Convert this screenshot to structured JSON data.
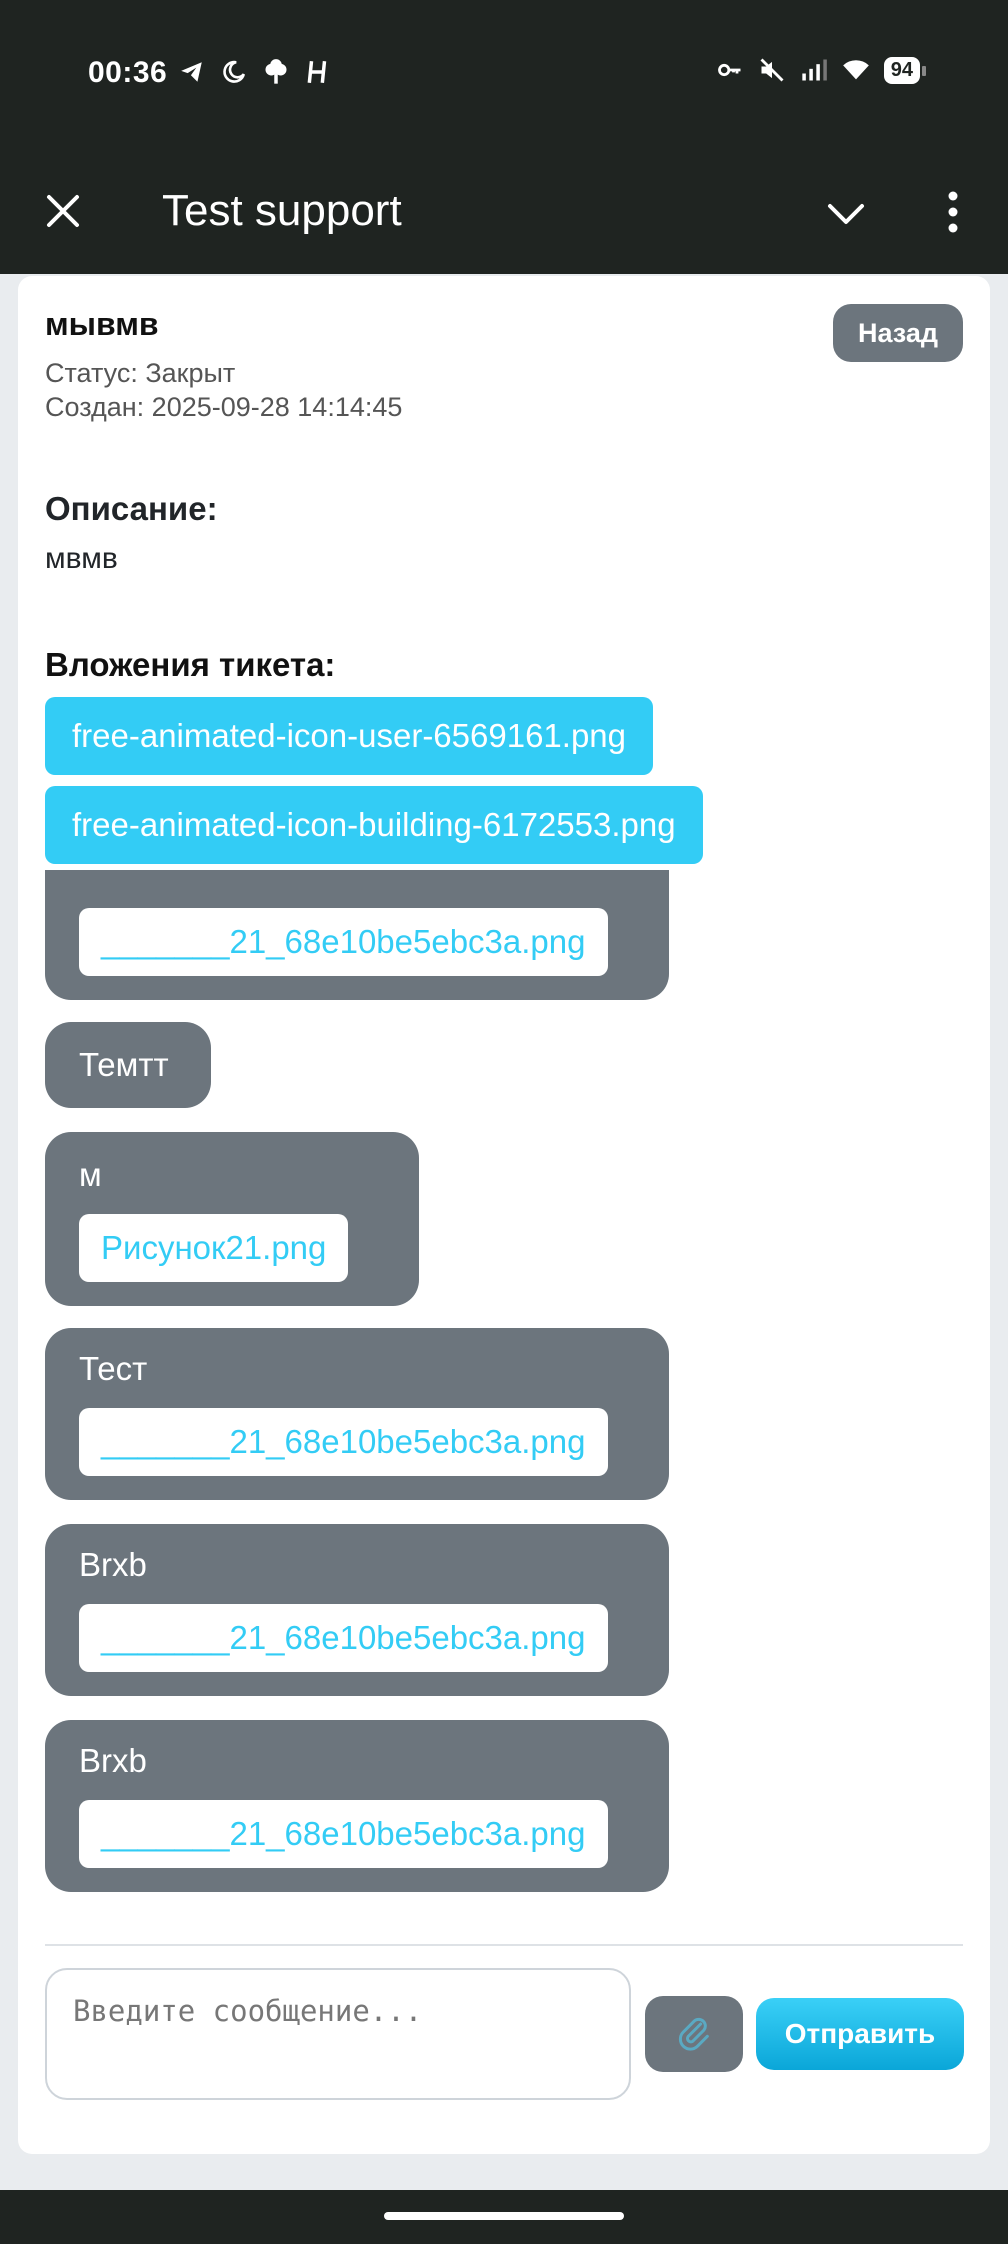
{
  "status_bar": {
    "time": "00:36",
    "battery": "94",
    "left_icons": [
      "telegram-icon",
      "moon-icon",
      "tree-icon",
      "h-icon"
    ],
    "right_icons": [
      "key-icon",
      "mute-icon",
      "signal-icon",
      "wifi-icon"
    ]
  },
  "app_bar": {
    "title": "Test support"
  },
  "ticket": {
    "title": "мывмв",
    "back_label": "Назад",
    "status": "Статус: Закрыт",
    "created": "Создан: 2025-09-28 14:14:45",
    "description_label": "Описание:",
    "description": "мвмв",
    "attachments_label": "Вложения тикета:",
    "attachments": [
      "free-animated-icon-user-6569161.png",
      "free-animated-icon-building-6172553.png"
    ]
  },
  "messages": [
    {
      "text": "",
      "file": "_______21_68e10be5ebc3a.png"
    },
    {
      "text": "Темтт",
      "file": ""
    },
    {
      "text": "м",
      "file": "Рисунок21.png"
    },
    {
      "text": "Тест",
      "file": "_______21_68e10be5ebc3a.png"
    },
    {
      "text": "Brxb",
      "file": "_______21_68e10be5ebc3a.png"
    },
    {
      "text": "Brxb",
      "file": "_______21_68e10be5ebc3a.png"
    }
  ],
  "composer": {
    "placeholder": "Введите сообщение...",
    "send_label": "Отправить",
    "attach_icon": "paperclip-icon"
  },
  "colors": {
    "accent": "#33ccf5",
    "bubble": "#6c757d",
    "bar": "#1f2421"
  }
}
